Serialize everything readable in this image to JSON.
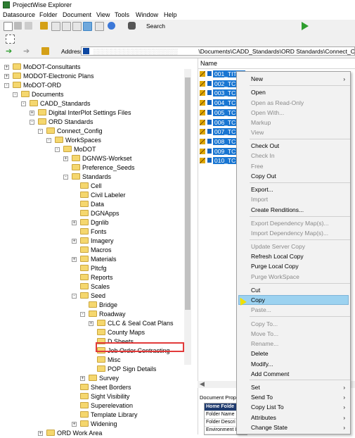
{
  "window": {
    "title": "ProjectWise Explorer"
  },
  "menubar": [
    "Datasource",
    "Folder",
    "Document",
    "View",
    "Tools",
    "Window",
    "Help"
  ],
  "toolbar": {
    "search_label": "Search"
  },
  "address": {
    "label": "Address",
    "value": "\\Documents\\CADD_Standards\\ORD Standards\\Connect_Con"
  },
  "tree": [
    {
      "label": "MoDOT-Consultants"
    },
    {
      "label": "MODOT-Electronic Plans"
    },
    {
      "label": "MoDOT-ORD"
    },
    {
      "label": "Documents"
    },
    {
      "label": "CADD_Standards"
    },
    {
      "label": "Digital InterPlot Settings Files"
    },
    {
      "label": "ORD Standards"
    },
    {
      "label": "Connect_Config"
    },
    {
      "label": "WorkSpaces"
    },
    {
      "label": "MoDOT"
    },
    {
      "label": "DGNWS-Workset"
    },
    {
      "label": "Preference_Seeds"
    },
    {
      "label": "Standards"
    },
    {
      "label": "Cell"
    },
    {
      "label": "Civil Labeler"
    },
    {
      "label": "Data"
    },
    {
      "label": "DGNApps"
    },
    {
      "label": "Dgnlib"
    },
    {
      "label": "Fonts"
    },
    {
      "label": "Imagery"
    },
    {
      "label": "Macros"
    },
    {
      "label": "Materials"
    },
    {
      "label": "Pltcfg"
    },
    {
      "label": "Reports"
    },
    {
      "label": "Scales"
    },
    {
      "label": "Seed"
    },
    {
      "label": "Bridge"
    },
    {
      "label": "Roadway"
    },
    {
      "label": "CLC & Seal Coat Plans"
    },
    {
      "label": "County Maps"
    },
    {
      "label": "D Sheets"
    },
    {
      "label": "Job Order Contracting"
    },
    {
      "label": "Misc"
    },
    {
      "label": "POP Sign Details"
    },
    {
      "label": "Survey"
    },
    {
      "label": "Sheet Borders"
    },
    {
      "label": "Sight Visibility"
    },
    {
      "label": "Superelevation"
    },
    {
      "label": "Template Library"
    },
    {
      "label": "Widening"
    },
    {
      "label": "ORD Work Area"
    }
  ],
  "list": {
    "column_name": "Name",
    "documents": [
      "001_TITLE",
      "002_TC",
      "003_TC",
      "004_TC",
      "005_TC",
      "006_TC",
      "007_TC",
      "008_TC",
      "009_TC",
      "010_TC"
    ]
  },
  "properties": {
    "header": "Document Prope",
    "rows": [
      "Home Folde",
      "Folder Name",
      "Folder Descri",
      "Environment I"
    ]
  },
  "context_menu": {
    "items": [
      "New",
      "Open",
      "Open as Read-Only",
      "Open With...",
      "Markup",
      "View",
      "Check Out",
      "Check In",
      "Free",
      "Copy Out",
      "Export...",
      "Import",
      "Create Renditions...",
      "Export Dependency Map(s)...",
      "Import Dependency Map(s)...",
      "Update Server Copy",
      "Refresh Local Copy",
      "Purge Local Copy",
      "Purge WorkSpace",
      "Cut",
      "Copy",
      "Paste...",
      "Copy To...",
      "Move To...",
      "Rename...",
      "Delete",
      "Modify...",
      "Add Comment",
      "Set",
      "Send To",
      "Copy List To",
      "Attributes",
      "Change State"
    ],
    "highlighted": "Copy"
  }
}
